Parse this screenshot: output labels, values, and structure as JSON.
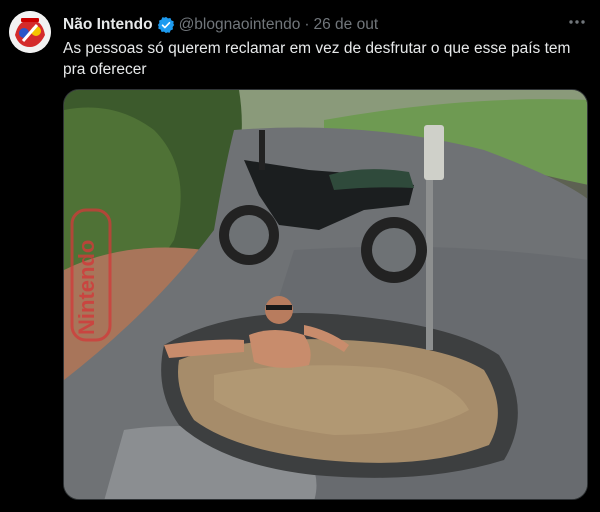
{
  "tweet": {
    "display_name": "Não Intendo",
    "handle": "@blognaointendo",
    "separator": "·",
    "date": "26 de out",
    "text": "As pessoas só querem reclamar em vez de desfrutar o que esse país tem pra oferecer",
    "more_icon": "more-horizontal-icon",
    "verified_icon": "verified-badge-icon"
  },
  "media": {
    "watermark": "Nintendo"
  },
  "colors": {
    "background": "#000000",
    "text_primary": "#e7e9ea",
    "text_secondary": "#71767b",
    "verified_blue": "#1d9bf0"
  }
}
